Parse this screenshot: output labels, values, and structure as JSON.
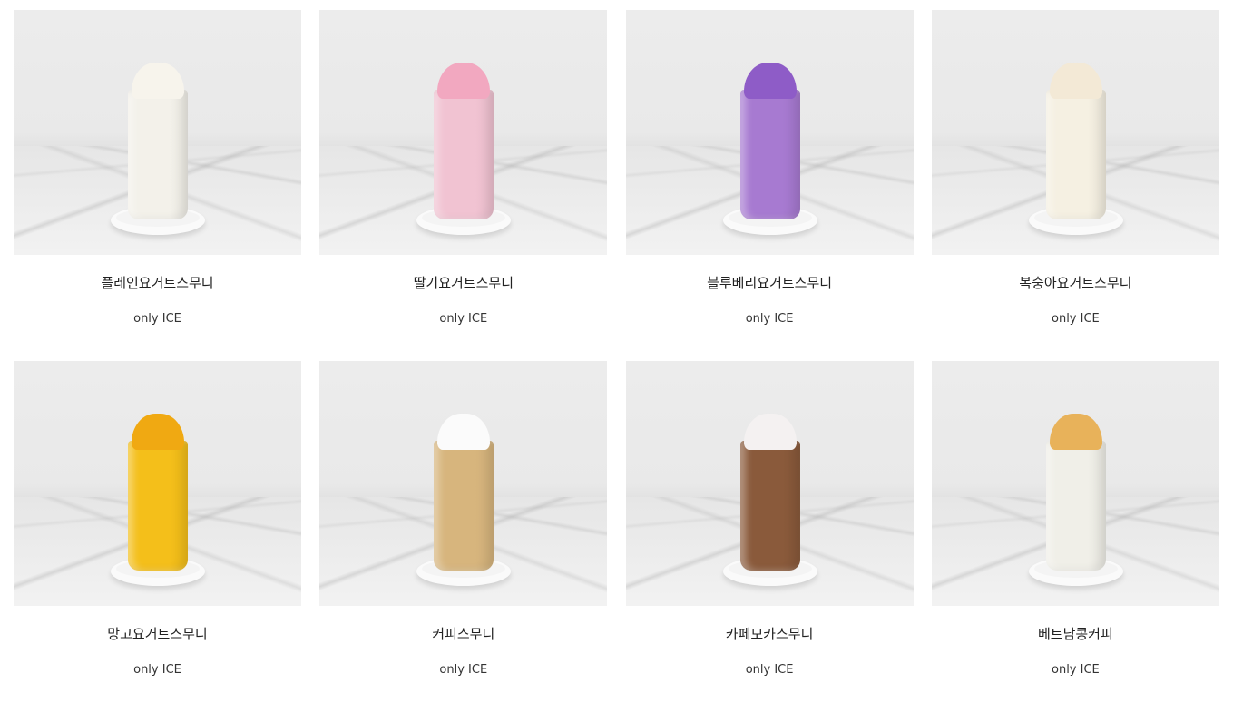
{
  "products": [
    {
      "name": "플레인요거트스무디",
      "temp": "only ICE",
      "cup_color": "#f3f1ea",
      "top_color": "#f7f4ec",
      "photo_icon": "plain-yogurt-smoothie-photo"
    },
    {
      "name": "딸기요거트스무디",
      "temp": "only ICE",
      "cup_color": "#f1c3d2",
      "top_color": "#f2a8c0",
      "photo_icon": "strawberry-yogurt-smoothie-photo"
    },
    {
      "name": "블루베리요거트스무디",
      "temp": "only ICE",
      "cup_color": "#a77ad1",
      "top_color": "#8e5cc7",
      "photo_icon": "blueberry-yogurt-smoothie-photo"
    },
    {
      "name": "복숭아요거트스무디",
      "temp": "only ICE",
      "cup_color": "#f5f0e2",
      "top_color": "#f3e9d6",
      "photo_icon": "peach-yogurt-smoothie-photo"
    },
    {
      "name": "망고요거트스무디",
      "temp": "only ICE",
      "cup_color": "#f4bf1a",
      "top_color": "#f0a912",
      "photo_icon": "mango-yogurt-smoothie-photo"
    },
    {
      "name": "커피스무디",
      "temp": "only ICE",
      "cup_color": "#d7b57d",
      "top_color": "#fbfbfb",
      "photo_icon": "coffee-smoothie-photo"
    },
    {
      "name": "카페모카스무디",
      "temp": "only ICE",
      "cup_color": "#8a5a3b",
      "top_color": "#f4f1f1",
      "photo_icon": "cafe-mocha-smoothie-photo"
    },
    {
      "name": "베트남콩커피",
      "temp": "only ICE",
      "cup_color": "#f0efe8",
      "top_color": "#e8b25a",
      "photo_icon": "vietnam-coconut-coffee-photo"
    }
  ]
}
